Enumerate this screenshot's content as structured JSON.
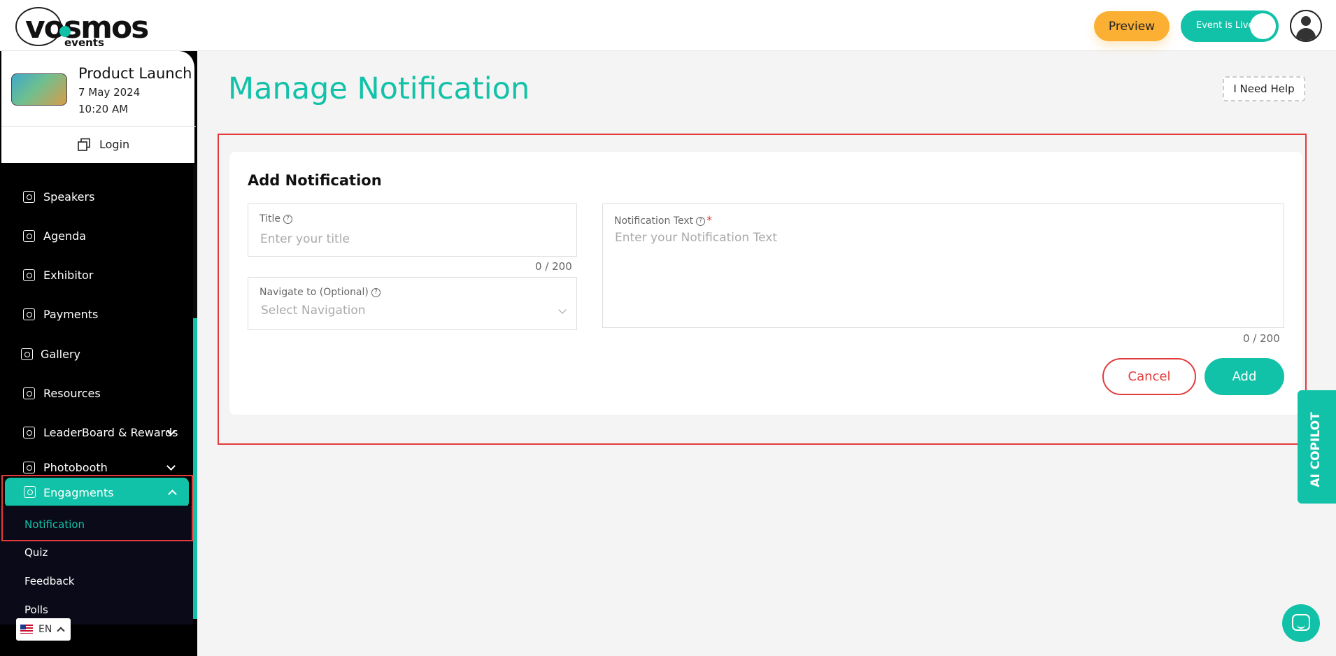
{
  "brand": {
    "logo_word": "vosmos",
    "logo_sub": "events",
    "accent": "#12c2a8",
    "danger": "#e23b3b",
    "preview_color": "#fbb033"
  },
  "header": {
    "preview_label": "Preview",
    "live_label": "Event is Live"
  },
  "event": {
    "name": "Product Launch",
    "date": "7 May 2024",
    "time": "10:20 AM",
    "login_label": "Login"
  },
  "sidebar": {
    "items": [
      {
        "label": "Speakers",
        "icon": "speaker-icon"
      },
      {
        "label": "Agenda",
        "icon": "agenda-icon"
      },
      {
        "label": "Exhibitor",
        "icon": "exhibitor-icon"
      },
      {
        "label": "Payments",
        "icon": "payments-icon"
      },
      {
        "label": "Gallery",
        "icon": "gallery-icon"
      },
      {
        "label": "Resources",
        "icon": "folder-icon"
      },
      {
        "label": "LeaderBoard & Rewards",
        "icon": "leaderboard-icon"
      },
      {
        "label": "Photobooth",
        "icon": "photobooth-icon"
      },
      {
        "label": "Engagments",
        "icon": "engagement-icon"
      }
    ],
    "sub_items": [
      "Notification",
      "Quiz",
      "Feedback",
      "Polls"
    ],
    "language": "EN"
  },
  "main": {
    "title": "Manage Notification",
    "help_label": "I Need Help",
    "form": {
      "heading": "Add Notification",
      "title_label": "Title",
      "title_placeholder": "Enter your title",
      "title_counter": "0 / 200",
      "nav_label": "Navigate to (Optional)",
      "nav_placeholder": "Select Navigation",
      "text_label": "Notification Text",
      "text_placeholder": "Enter your Notification Text",
      "text_counter": "0 / 200",
      "required_mark": "*",
      "cancel_label": "Cancel",
      "add_label": "Add"
    }
  },
  "copilot_label": "AI COPILOT"
}
